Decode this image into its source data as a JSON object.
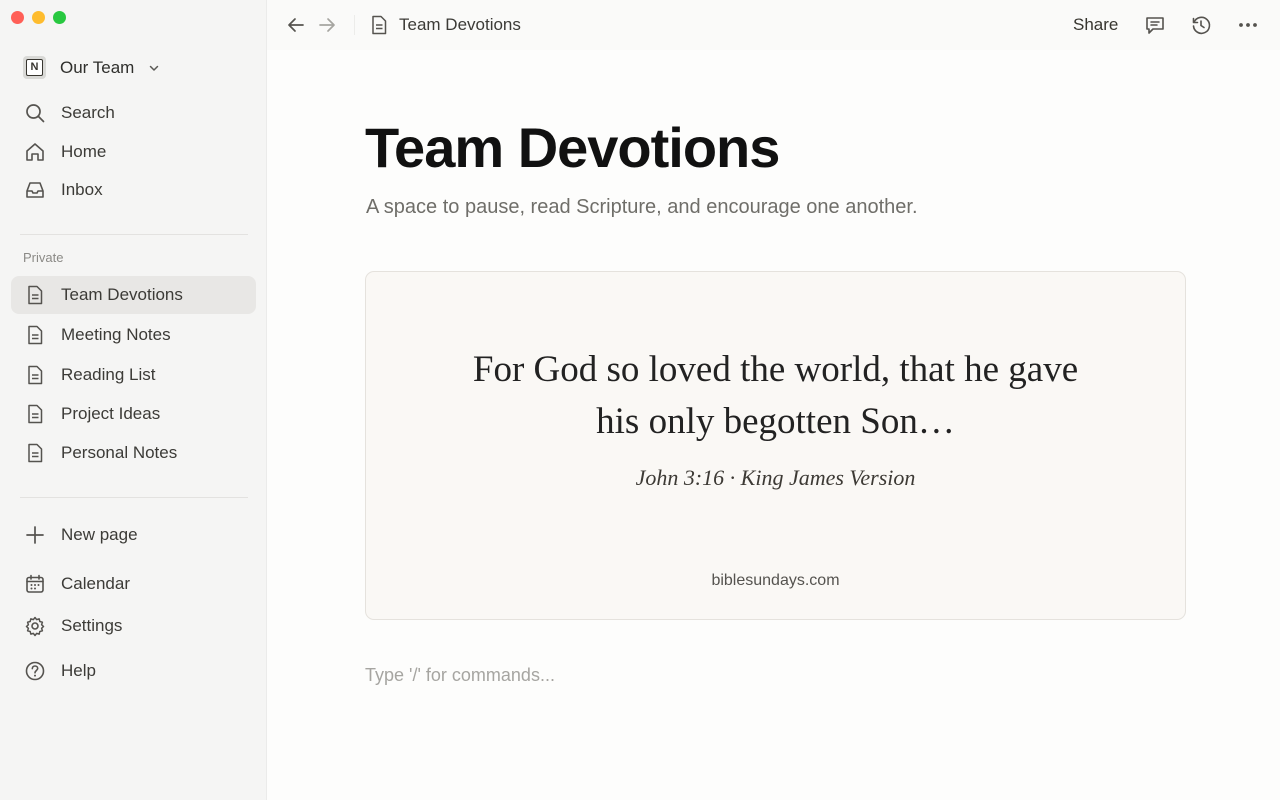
{
  "window": {
    "controls": [
      "close",
      "minimize",
      "maximize"
    ]
  },
  "workspace": {
    "name": "Our Team",
    "icon": "notion-logo-icon"
  },
  "sidebar": {
    "top_items": [
      {
        "label": "Search",
        "icon": "search-icon"
      },
      {
        "label": "Home",
        "icon": "home-icon"
      },
      {
        "label": "Inbox",
        "icon": "inbox-icon"
      }
    ],
    "section_label": "Private",
    "pages": [
      {
        "label": "Team Devotions",
        "icon": "page-icon",
        "active": true
      },
      {
        "label": "Meeting Notes",
        "icon": "page-icon"
      },
      {
        "label": "Reading List",
        "icon": "page-icon"
      },
      {
        "label": "Project Ideas",
        "icon": "page-icon"
      },
      {
        "label": "Personal Notes",
        "icon": "page-icon"
      }
    ],
    "bottom_items": [
      {
        "label": "New page",
        "icon": "plus-icon"
      },
      {
        "label": "Calendar",
        "icon": "calendar-icon"
      },
      {
        "label": "Settings",
        "icon": "gear-icon"
      },
      {
        "label": "Help",
        "icon": "help-icon"
      }
    ]
  },
  "topbar": {
    "breadcrumb_title": "Team Devotions",
    "share_label": "Share",
    "icons": [
      "back-arrow-icon",
      "forward-arrow-icon",
      "page-icon",
      "comment-icon",
      "history-icon",
      "more-icon"
    ]
  },
  "page": {
    "title": "Team Devotions",
    "subtitle": "A space to pause, read Scripture, and encourage one another.",
    "verse": {
      "line1": "For God so loved the world, that he gave",
      "line2": "his only begotten Son…",
      "reference": "John 3:16 · King James Version",
      "source": "biblesundays.com"
    },
    "command_placeholder": "Type '/' for commands..."
  },
  "colors": {
    "sidebar_bg": "#f5f5f4",
    "active_item_bg": "#e8e7e5",
    "card_bg": "#faf8f5",
    "title_color": "#111111"
  }
}
